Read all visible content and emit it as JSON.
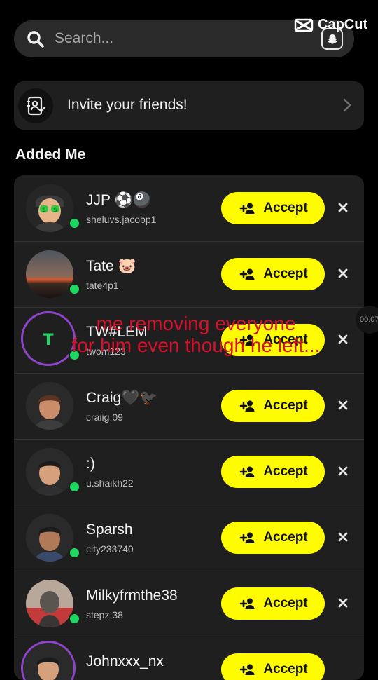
{
  "search": {
    "placeholder": "Search..."
  },
  "watermark": "CapCut",
  "invite": {
    "label": "Invite your friends!"
  },
  "section_title": "Added Me",
  "accept_label": "Accept",
  "requests": [
    {
      "name": "JJP ⚽🎱",
      "username": "sheluvs.jacobp1",
      "online": true
    },
    {
      "name": "Tate 🐷",
      "username": "tate4p1",
      "online": true
    },
    {
      "name": "TW#LEM",
      "username": "twom123",
      "online": true
    },
    {
      "name": "Craig🖤🐦‍⬛",
      "username": "craiig.09",
      "online": false
    },
    {
      "name": ":)",
      "username": "u.shaikh22",
      "online": true
    },
    {
      "name": "Sparsh",
      "username": "city233740",
      "online": true
    },
    {
      "name": "Milkyfrmthe38",
      "username": "stepz.38",
      "online": true
    },
    {
      "name": "Johnxxx_nx",
      "username": "",
      "online": false
    }
  ],
  "overlay": {
    "line1": "me removing everyone",
    "line2": "for him even though he left..."
  },
  "timer": "00:07",
  "colors": {
    "accent": "#fffc00",
    "online": "#1ed760",
    "overlay_text": "#d8102c",
    "ring": "#8e44c9"
  }
}
